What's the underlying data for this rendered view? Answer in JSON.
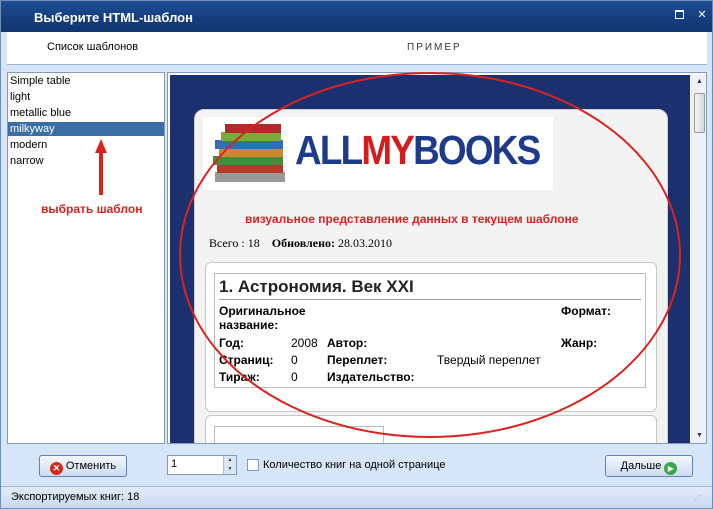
{
  "window": {
    "title": "Выберите HTML-шаблон"
  },
  "header": {
    "list_title": "Список шаблонов",
    "preview_title": "ПРИМЕР"
  },
  "templates": {
    "items": [
      "Simple table",
      "light",
      "metallic blue",
      "milkyway",
      "modern",
      "narrow"
    ],
    "selected": "milkyway"
  },
  "annotations": {
    "choose_template": "выбрать шаблон",
    "preview_note": "визуальное представление данных в текущем шаблоне",
    "color": "#d9231f"
  },
  "preview": {
    "logo": {
      "part1": "ALL",
      "part2": "MY",
      "part3": "BOOKS"
    },
    "stats": {
      "total_label": "Всего :",
      "total_value": "18",
      "updated_label": "Обновлено:",
      "updated_value": "28.03.2010"
    },
    "book": {
      "title": "1. Астрономия. Век XXI",
      "original_name_label": "Оригинальное название:",
      "format_label": "Формат:",
      "year_label": "Год:",
      "year_value": "2008",
      "author_label": "Автор:",
      "genre_label": "Жанр:",
      "pages_label": "Страниц:",
      "pages_value": "0",
      "binding_label": "Переплет:",
      "binding_value": "Твердый переплет",
      "print_run_label": "Тираж:",
      "print_run_value": "0",
      "publisher_label": "Издательство:"
    }
  },
  "toolbar": {
    "cancel_label": "Отменить",
    "per_page_value": "1",
    "books_per_page_label": "Количество книг на одной странице",
    "next_label": "Дальше"
  },
  "status": {
    "exported_text": "Экспортируемых книг: 18"
  },
  "colors": {
    "titlebar": "#163e7d",
    "preview_bg": "#1c2f6e",
    "selection": "#3a6ea5",
    "accent_red": "#d9231f"
  }
}
